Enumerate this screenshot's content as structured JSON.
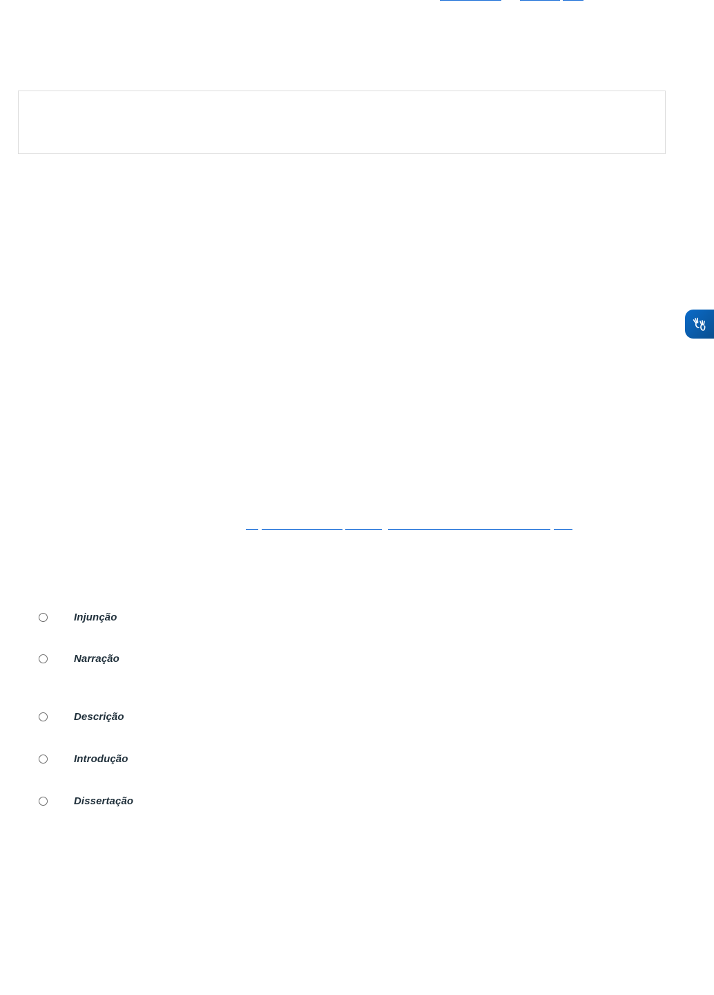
{
  "accessibility_widget": {
    "icon": "sign-language-hands-icon",
    "color": "#0a5fae"
  },
  "question": {
    "options": [
      {
        "label": "Injunção",
        "selected": false
      },
      {
        "label": "Narração",
        "selected": false
      },
      {
        "label": "Descrição",
        "selected": false
      },
      {
        "label": "Introdução",
        "selected": false
      },
      {
        "label": "Dissertação",
        "selected": false
      }
    ]
  }
}
